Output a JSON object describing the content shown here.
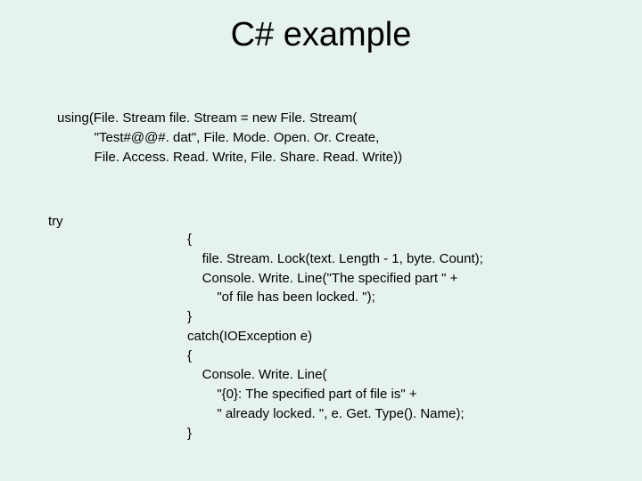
{
  "title": "C# example",
  "code": {
    "using_l1": "using(File. Stream file. Stream = new File. Stream(",
    "using_l2": "          \"Test#@@#. dat\", File. Mode. Open. Or. Create,",
    "using_l3": "          File. Access. Read. Write, File. Share. Read. Write))",
    "try": "try",
    "b2_l1": "{",
    "b2_l2": "    file. Stream. Lock(text. Length - 1, byte. Count);",
    "b2_l3": "    Console. Write. Line(\"The specified part \" +",
    "b2_l4": "        \"of file has been locked. \");",
    "b2_l5": "}",
    "b2_l6": "catch(IOException e)",
    "b2_l7": "{",
    "b2_l8": "    Console. Write. Line(",
    "b2_l9": "        \"{0}: The specified part of file is\" +",
    "b2_l10": "        \" already locked. \", e. Get. Type(). Name);",
    "b2_l11": "}"
  }
}
